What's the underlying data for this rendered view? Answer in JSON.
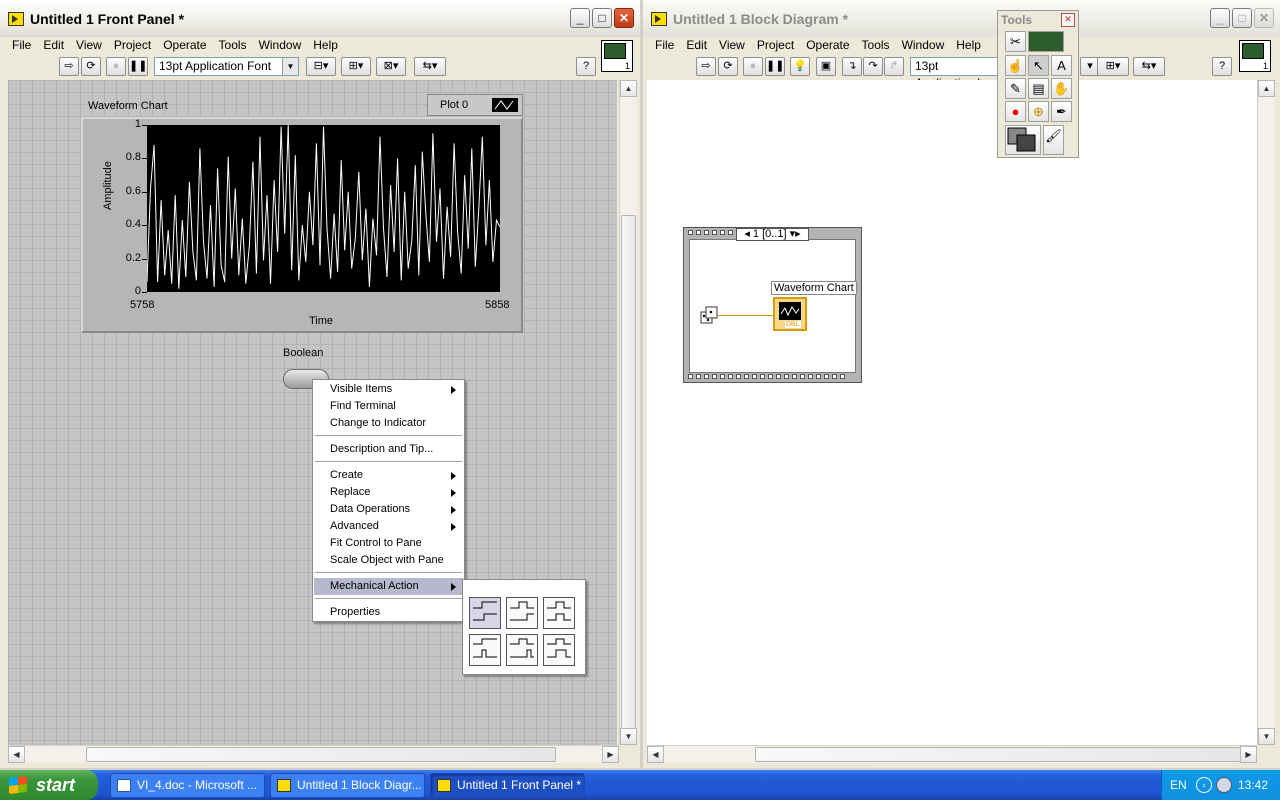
{
  "front_panel": {
    "title": "Untitled 1 Front Panel *",
    "menus": [
      "File",
      "Edit",
      "View",
      "Project",
      "Operate",
      "Tools",
      "Window",
      "Help"
    ],
    "font_selector": "13pt Application Font",
    "vi_icon_number": "1",
    "chart": {
      "label": "Waveform Chart",
      "legend": "Plot 0",
      "ylabel": "Amplitude",
      "xlabel": "Time",
      "yticks": [
        "1",
        "0.8",
        "0.6",
        "0.4",
        "0.2",
        "0"
      ],
      "x_min": "5758",
      "x_max": "5858"
    },
    "boolean": {
      "label": "Boolean"
    },
    "context_menu": {
      "items": [
        "Visible Items",
        "Find Terminal",
        "Change to Indicator",
        "Description and Tip...",
        "Create",
        "Replace",
        "Data Operations",
        "Advanced",
        "Fit Control to Pane",
        "Scale Object with Pane",
        "Mechanical Action",
        "Properties"
      ]
    }
  },
  "block_diagram": {
    "title": "Untitled 1 Block Diagram *",
    "menus": [
      "File",
      "Edit",
      "View",
      "Project",
      "Operate",
      "Tools",
      "Window",
      "Help"
    ],
    "font_selector": "13pt Application I",
    "vi_icon_number": "1",
    "sequence_selector": "1 [0..1]",
    "terminal_label": "Waveform Chart",
    "terminal_type": "DBL"
  },
  "tools_palette": {
    "title": "Tools"
  },
  "taskbar": {
    "start": "start",
    "tasks": [
      "VI_4.doc - Microsoft ...",
      "Untitled 1 Block Diagr...",
      "Untitled 1 Front Panel *"
    ],
    "lang": "EN",
    "clock": "13:42"
  },
  "chart_data": {
    "type": "line",
    "title": "Waveform Chart",
    "xlabel": "Time",
    "ylabel": "Amplitude",
    "xlim": [
      5758,
      5858
    ],
    "ylim": [
      0,
      1
    ],
    "series": [
      {
        "name": "Plot 0",
        "x_start": 5758,
        "values": [
          0.06,
          0.62,
          0.88,
          0.06,
          0.55,
          0.1,
          0.37,
          0.05,
          0.58,
          0.02,
          0.43,
          0.09,
          0.66,
          0.24,
          0.07,
          0.86,
          0.3,
          0.08,
          0.52,
          0.03,
          0.74,
          0.16,
          0.06,
          0.81,
          0.2,
          0.62,
          0.1,
          0.44,
          0.05,
          0.28,
          0.78,
          0.11,
          0.93,
          0.19,
          0.58,
          0.05,
          0.67,
          0.24,
          0.99,
          0.35,
          1.0,
          0.13,
          0.82,
          0.07,
          0.4,
          0.18,
          0.6,
          0.28,
          0.89,
          0.16,
          0.99,
          0.38,
          0.08,
          0.47,
          0.12,
          0.79,
          0.25,
          0.6,
          0.14,
          0.32,
          0.72,
          0.19,
          0.5,
          0.03,
          0.44,
          0.22,
          0.93,
          0.38,
          0.09,
          0.64,
          0.24,
          0.8,
          0.07,
          0.6,
          0.14,
          0.31,
          0.76,
          0.1,
          0.84,
          0.46,
          0.18,
          0.95,
          0.3,
          0.62,
          0.08,
          0.51,
          0.21,
          0.89,
          0.36,
          0.11,
          0.7,
          0.26,
          0.86,
          0.15,
          0.5,
          0.93,
          0.28,
          0.67,
          0.18,
          0.43,
          0.39
        ]
      }
    ]
  }
}
